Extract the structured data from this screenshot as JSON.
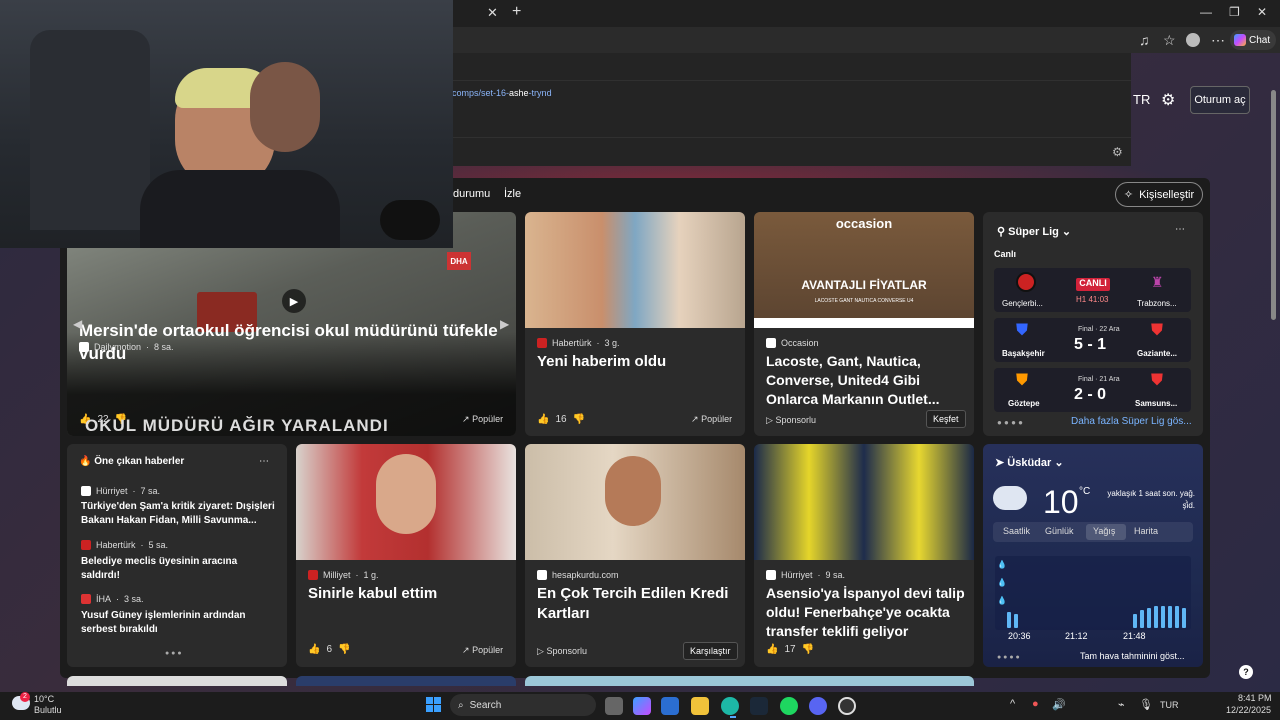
{
  "browser": {
    "tab_close": "✕",
    "new_tab": "+",
    "chat_label": "Chat",
    "url_suggestion_prefix": "comps/set-16-",
    "url_suggestion_bold": "ashe",
    "url_suggestion_suffix": "-trynd"
  },
  "header": {
    "language": "TR",
    "login_label": "Oturum aç"
  },
  "nav": {
    "tabs": [
      "durumu",
      "İzle"
    ],
    "personalize_label": "Kişiselleştir"
  },
  "hero": {
    "source": "Dailymotion",
    "time": "8 sa.",
    "title": "Mersin'de ortaokul öğrencisi okul müdürünü tüfekle vurdu",
    "likes": "22",
    "popular_label": "Popüler",
    "overlay_text": "OKUL MÜDÜRÜ AĞIR YARALANDI",
    "brand_tag": "DHA"
  },
  "card_haberturk": {
    "source": "Habertürk",
    "time": "3 g.",
    "title": "Yeni haberim oldu",
    "likes": "16",
    "popular_label": "Popüler"
  },
  "card_occasion": {
    "source": "Occasion",
    "title": "Lacoste, Gant, Nautica, Converse, United4 Gibi Onlarca Markanın Outlet...",
    "sponsored": "Sponsorlu",
    "cta": "Keşfet",
    "img_brand": "occasion",
    "img_headline": "AVANTAJLI FİYATLAR",
    "img_brands": "LACOSTE   GANT   NAUTICA   CONVERSE   U4"
  },
  "superlig": {
    "title": "Süper Lig",
    "live_label": "Canlı",
    "matches": [
      {
        "home": "Gençlerbi...",
        "away": "Trabzons...",
        "status": "CANLI",
        "detail": "H1 41:03",
        "score": ""
      },
      {
        "home": "Başakşehir",
        "away": "Gaziante...",
        "status": "Final · 22 Ara",
        "detail": "",
        "score": "5 - 1"
      },
      {
        "home": "Göztepe",
        "away": "Samsuns...",
        "status": "Final · 21 Ara",
        "detail": "",
        "score": "2 - 0"
      }
    ],
    "more_label": "Daha fazla Süper Lig gös..."
  },
  "trending": {
    "title": "Öne çıkan haberler",
    "items": [
      {
        "source": "Hürriyet",
        "time": "7 sa.",
        "title": "Türkiye'den Şam'a kritik ziyaret: Dışişleri Bakanı Hakan Fidan, Milli Savunma..."
      },
      {
        "source": "Habertürk",
        "time": "5 sa.",
        "title": "Belediye meclis üyesinin aracına saldırdı!"
      },
      {
        "source": "İHA",
        "time": "3 sa.",
        "title": "Yusuf Güney işlemlerinin ardından serbest bırakıldı"
      }
    ]
  },
  "card_milliyet": {
    "source": "Milliyet",
    "time": "1 g.",
    "title": "Sinirle kabul ettim",
    "likes": "6",
    "popular_label": "Popüler"
  },
  "card_hesap": {
    "source": "hesapkurdu.com",
    "title": "En Çok Tercih Edilen Kredi Kartları",
    "sponsored": "Sponsorlu",
    "cta": "Karşılaştır"
  },
  "card_asensio": {
    "source": "Hürriyet",
    "time": "9 sa.",
    "title": "Asensio'ya İspanyol devi talip oldu! Fenerbahçe'ye ocakta transfer teklifi geliyor",
    "likes": "17"
  },
  "weather": {
    "location": "Üsküdar",
    "temp": "10",
    "unit": "°C",
    "rain_note": "yaklaşık 1 saat son. yağ. şid.",
    "tabs": [
      "Saatlik",
      "Günlük",
      "Yağış",
      "Harita"
    ],
    "times": [
      "20:36",
      "21:12",
      "21:48"
    ],
    "full_forecast": "Tam hava tahminini göst..."
  },
  "taskbar": {
    "weather_temp": "10°C",
    "weather_desc": "Bulutlu",
    "search_placeholder": "Search",
    "lang": "TUR",
    "time": "8:41 PM",
    "date": "12/22/2025",
    "notif_badge": "2"
  }
}
